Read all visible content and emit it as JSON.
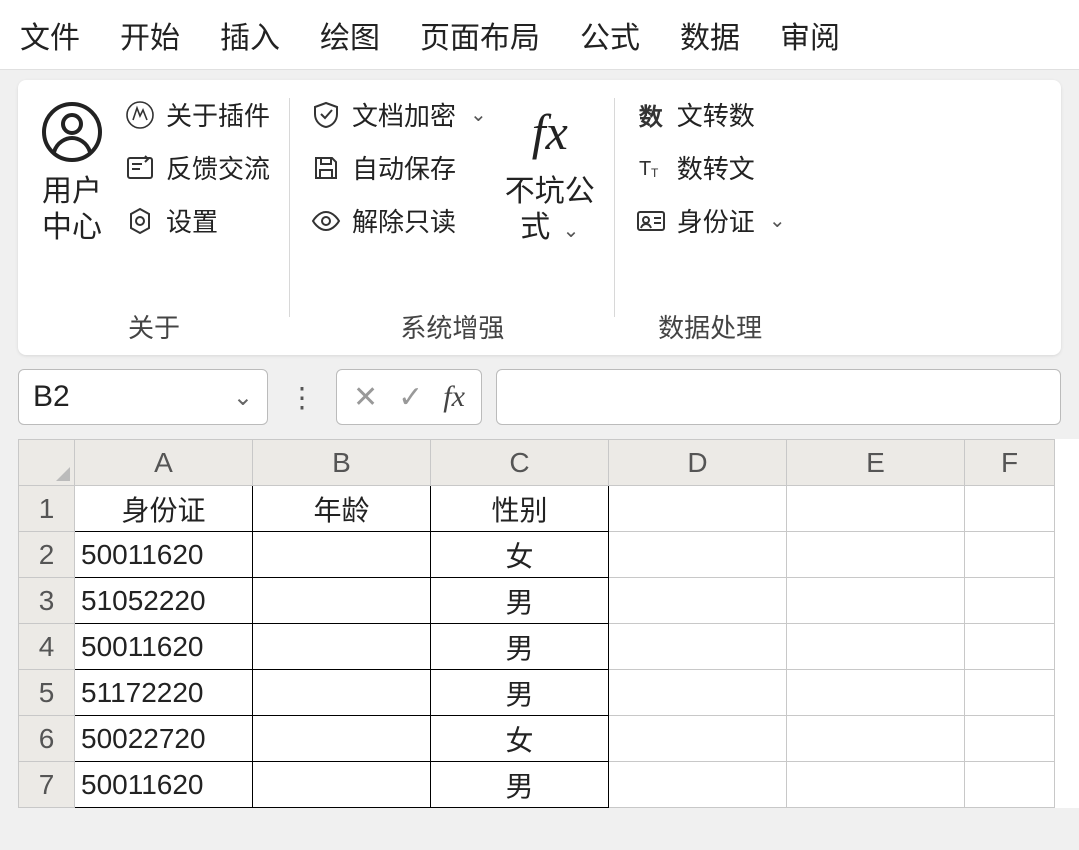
{
  "menu": [
    "文件",
    "开始",
    "插入",
    "绘图",
    "页面布局",
    "公式",
    "数据",
    "审阅"
  ],
  "ribbon": {
    "g1": {
      "userCenter": "用户\n中心",
      "about": "关于插件",
      "feedback": "反馈交流",
      "settings": "设置",
      "label": "关于"
    },
    "g2": {
      "encrypt": "文档加密",
      "autosave": "自动保存",
      "unlock": "解除只读",
      "formula": "不坑公\n式",
      "label": "系统增强"
    },
    "g3": {
      "textToNum": "文转数",
      "numToText": "数转文",
      "idcard": "身份证",
      "numIcon": "数",
      "label": "数据处理"
    }
  },
  "nameBox": "B2",
  "fxLabel": "fx",
  "columns": [
    "A",
    "B",
    "C",
    "D",
    "E",
    "F"
  ],
  "rows": [
    "1",
    "2",
    "3",
    "4",
    "5",
    "6",
    "7"
  ],
  "headers": [
    "身份证",
    "年龄",
    "性别"
  ],
  "data": [
    [
      "50011620",
      "",
      "女"
    ],
    [
      "51052220",
      "",
      "男"
    ],
    [
      "50011620",
      "",
      "男"
    ],
    [
      "51172220",
      "",
      "男"
    ],
    [
      "50022720",
      "",
      "女"
    ],
    [
      "50011620",
      "",
      "男"
    ]
  ]
}
